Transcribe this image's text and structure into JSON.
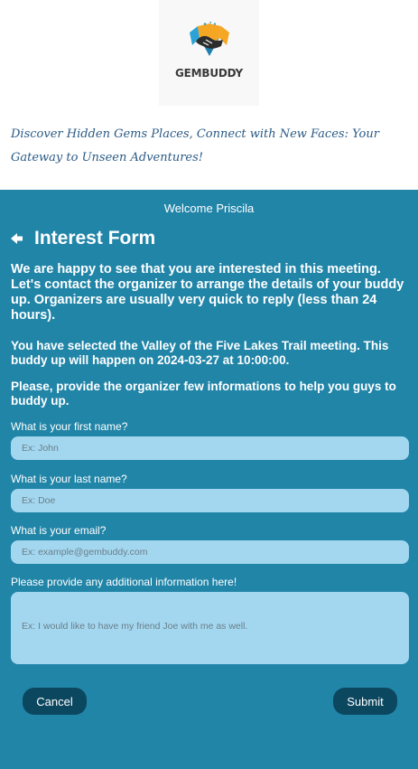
{
  "brand": {
    "name": "GEMBUDDY",
    "tagline": "Discover Hidden Gems Places, Connect with New Faces: Your Gateway to Unseen Adventures!",
    "colors": {
      "accent_blue": "#2185a8",
      "dark_button": "#0c4760",
      "input_bg": "#a3d7f0",
      "tagline": "#2a5a86",
      "logo_orange": "#f5a623",
      "logo_blue": "#2ba3d8"
    }
  },
  "welcome": "Welcome Priscila",
  "form": {
    "title": "Interest Form",
    "back_icon": "back-arrow-icon",
    "intro": "We are happy to see that you are interested in this meeting. Let's contact the organizer to arrange the details of your buddy up. Organizers are usually very quick to reply (less than 24 hours).",
    "selected_meeting": "You have selected the Valley of the Five Lakes Trail meeting. This buddy up will happen on 2024-03-27 at 10:00:00.",
    "provide_info": "Please, provide the organizer few informations to help you guys to buddy up.",
    "fields": {
      "first_name": {
        "label": "What is your first name?",
        "placeholder": "Ex: John",
        "value": ""
      },
      "last_name": {
        "label": "What is your last name?",
        "placeholder": "Ex: Doe",
        "value": ""
      },
      "email": {
        "label": "What is your email?",
        "placeholder": "Ex: example@gembuddy.com",
        "value": ""
      },
      "additional": {
        "label": "Please provide any additional information here!",
        "placeholder": "Ex: I would like to have my friend Joe with me as well.",
        "value": ""
      }
    },
    "buttons": {
      "cancel": "Cancel",
      "submit": "Submit"
    }
  }
}
